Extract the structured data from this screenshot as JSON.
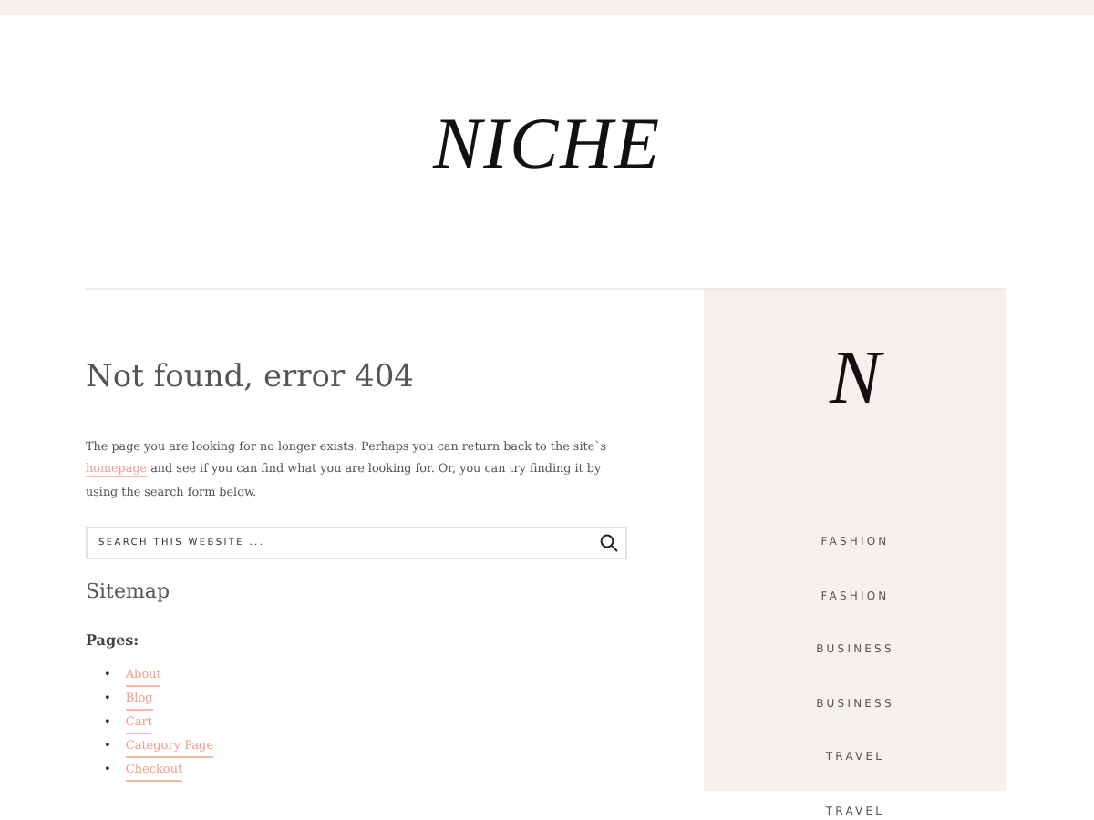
{
  "logo": "NICHE",
  "heading": "Not found, error 404",
  "message": {
    "before": "The page you are looking for no longer exists. Perhaps you can return back to the site`s ",
    "link": "homepage",
    "after": " and see if you can find what you are looking for. Or, you can try finding it by using the search form below."
  },
  "search": {
    "placeholder": "SEARCH THIS WEBSITE ..."
  },
  "sitemap_title": "Sitemap",
  "pages_title": "Pages:",
  "pages": [
    {
      "bullet": "•",
      "label": "About"
    },
    {
      "bullet": "•",
      "label": "Blog"
    },
    {
      "bullet": "•",
      "label": "Cart"
    },
    {
      "bullet": "•",
      "label": "Category Page"
    },
    {
      "bullet": "•",
      "label": "Checkout"
    }
  ],
  "sidebar": {
    "logo": "N",
    "items": [
      "FASHION",
      "FASHION",
      "BUSINESS",
      "BUSINESS",
      "TRAVEL",
      "TRAVEL"
    ]
  }
}
